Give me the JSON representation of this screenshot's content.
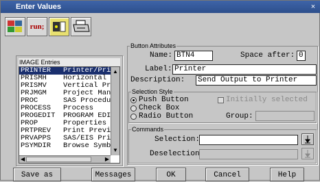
{
  "window": {
    "title": "Enter Values",
    "close_glyph": "×"
  },
  "toolbar": {
    "icons": [
      "image-catalog-icon",
      "run-icon",
      "keys-icon",
      "printer-icon"
    ],
    "run_text": "run;"
  },
  "image_entries": {
    "title": "IMAGE Entries",
    "rows": [
      {
        "name": "PRINTER",
        "desc": "Printer/Pri"
      },
      {
        "name": "PRISMH",
        "desc": "Horizontal"
      },
      {
        "name": "PRISMV",
        "desc": "Vertical Pr"
      },
      {
        "name": "PRJMGM",
        "desc": "Project Man"
      },
      {
        "name": "PROC",
        "desc": "SAS Procedu"
      },
      {
        "name": "PROCESS",
        "desc": "Process"
      },
      {
        "name": "PROGEDIT",
        "desc": "PROGRAM EDI"
      },
      {
        "name": "PROP",
        "desc": "Properties"
      },
      {
        "name": "PRTPREV",
        "desc": "Print Previ"
      },
      {
        "name": "PRVAPPS",
        "desc": "SAS/EIS Pri"
      },
      {
        "name": "PSYMDIR",
        "desc": "Browse Symb"
      }
    ]
  },
  "attributes": {
    "section_title": "Button Attributes",
    "name_label": "Name:",
    "name_value": "BTN4",
    "space_after_label": "Space after:",
    "space_after_value": "0",
    "label_label": "Label:",
    "label_value": "Printer",
    "description_label": "Description:",
    "description_value": "Send Output to Printer"
  },
  "selection_style": {
    "section_title": "Selection Style",
    "push_button": "Push Button",
    "check_box": "Check Box",
    "radio_button": "Radio Button",
    "initially_selected": "Initially selected",
    "group_label": "Group:"
  },
  "commands": {
    "section_title": "Commands",
    "selection_label": "Selection:",
    "deselection_label": "Deselection:"
  },
  "buttons": {
    "save_as": "Save as",
    "messages": "Messages",
    "ok": "OK",
    "cancel": "Cancel",
    "help": "Help"
  }
}
